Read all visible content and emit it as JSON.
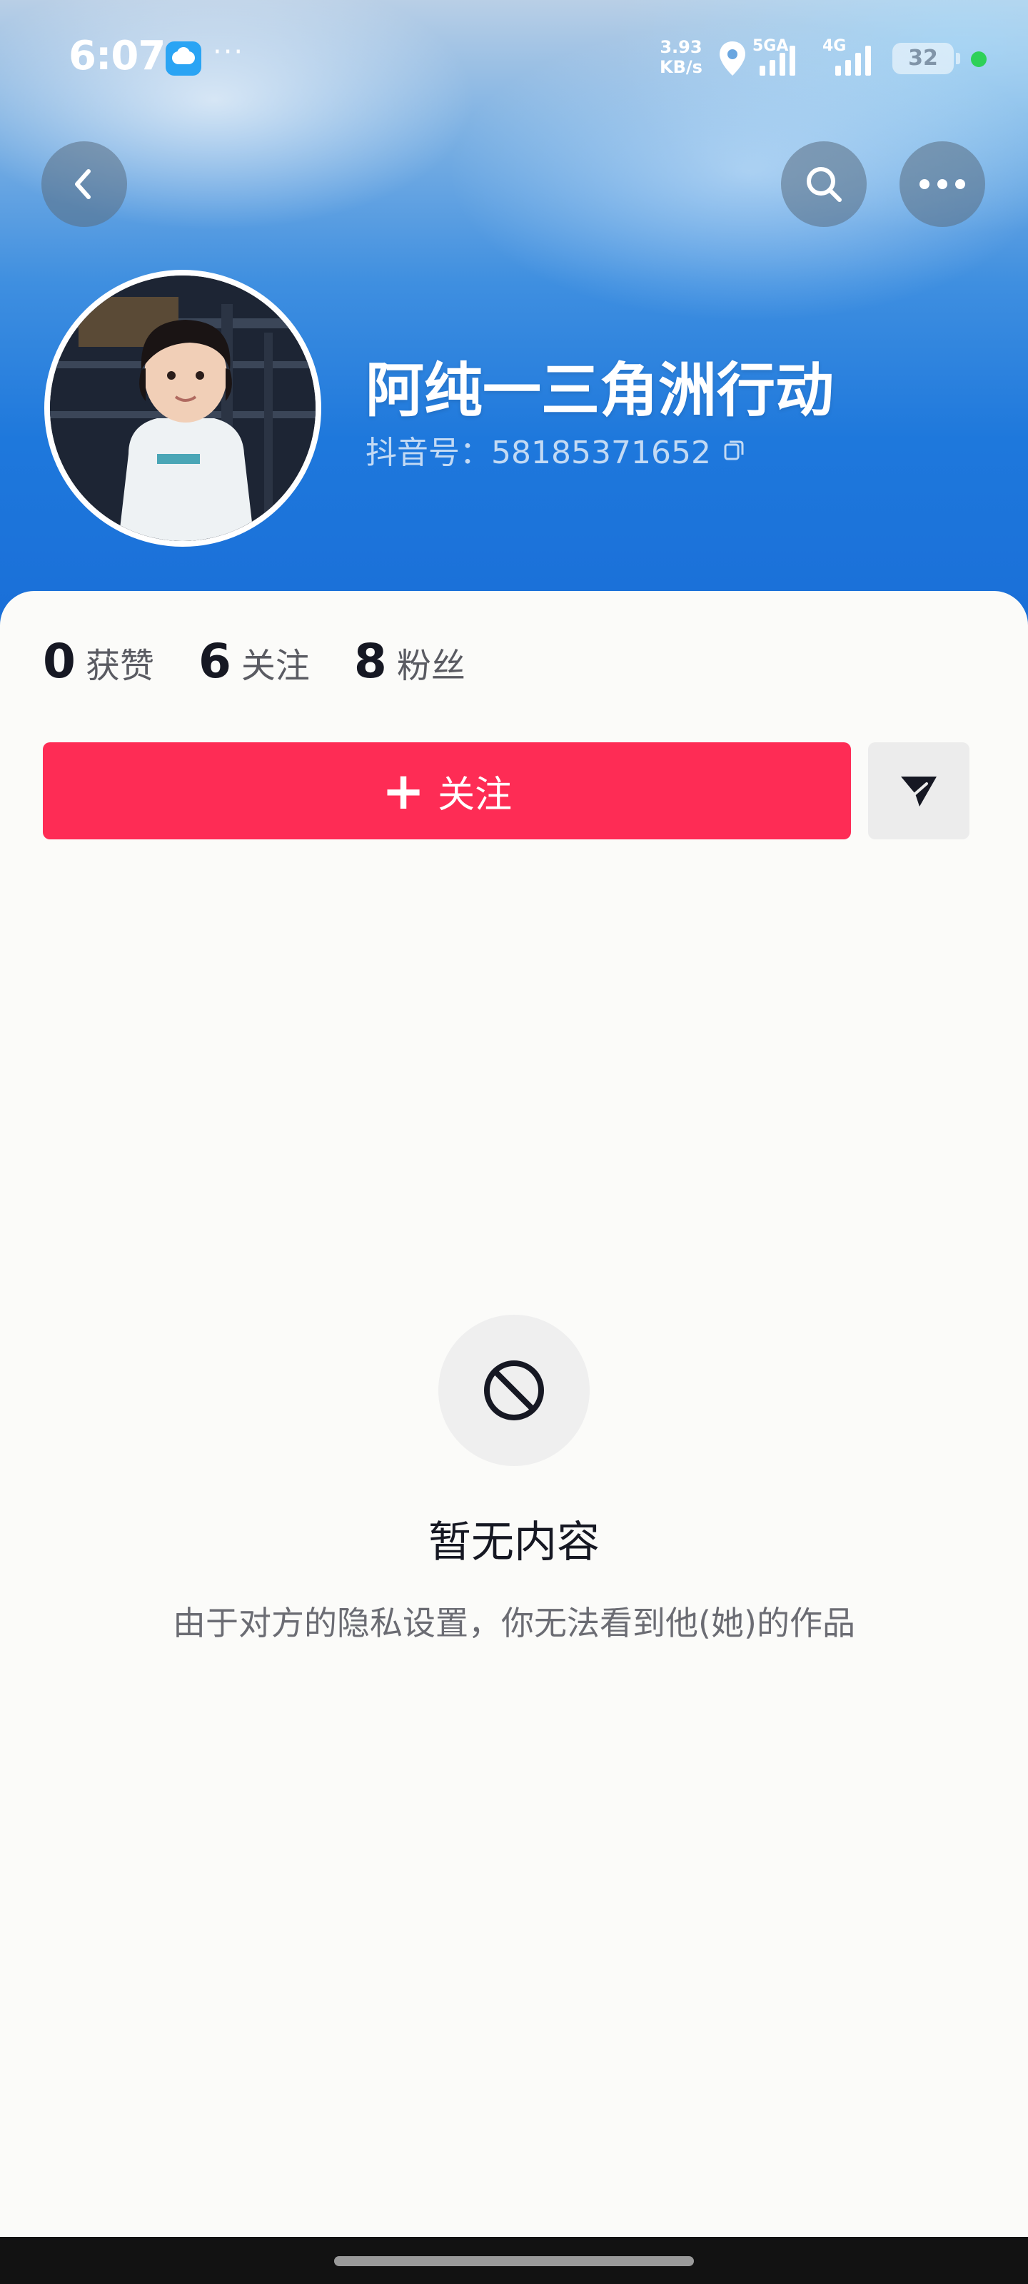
{
  "status_bar": {
    "time": "6:07",
    "dots": "···",
    "net_speed_value": "3.93",
    "net_speed_unit": "KB/s",
    "network_1": "5GA",
    "network_2": "4G",
    "battery": "32"
  },
  "profile": {
    "username": "阿纯一三角洲行动",
    "douyin_id": "抖音号：58185371652"
  },
  "stats": [
    {
      "value": "0",
      "label": "获赞"
    },
    {
      "value": "6",
      "label": "关注"
    },
    {
      "value": "8",
      "label": "粉丝"
    }
  ],
  "actions": {
    "follow_plus": "+",
    "follow_label": "关注"
  },
  "empty_state": {
    "title": "暂无内容",
    "description": "由于对方的隐私设置，你无法看到他(她)的作品"
  },
  "colors": {
    "accent": "#fe2c55",
    "header_blue": "#1e78dc"
  }
}
